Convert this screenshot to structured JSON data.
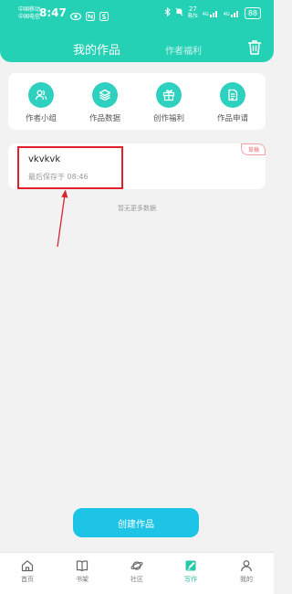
{
  "status_bar": {
    "carrier_1": "中国移动",
    "carrier_2": "中国电信",
    "time": "8:47",
    "network_speed": "27",
    "network_unit": "B/s",
    "network_type": "4G",
    "network_type_2": "4G",
    "battery": "88"
  },
  "header": {
    "tabs": [
      {
        "label": "我的作品",
        "active": true
      },
      {
        "label": "作者福利",
        "active": false
      }
    ]
  },
  "quick_actions": [
    {
      "label": "作者小组",
      "icon": "people-icon"
    },
    {
      "label": "作品数据",
      "icon": "layers-icon"
    },
    {
      "label": "创作福利",
      "icon": "gift-icon"
    },
    {
      "label": "作品申请",
      "icon": "document-icon"
    }
  ],
  "work": {
    "title": "vkvkvk",
    "save_time": "最后保存于 08:46",
    "badge": "草稿"
  },
  "list_end_text": "暂无更多数据",
  "create_button": "创建作品",
  "tab_bar": [
    {
      "label": "首页",
      "icon": "home-icon",
      "active": false
    },
    {
      "label": "书架",
      "icon": "book-icon",
      "active": false
    },
    {
      "label": "社区",
      "icon": "planet-icon",
      "active": false
    },
    {
      "label": "写作",
      "icon": "pen-icon",
      "active": true
    },
    {
      "label": "我的",
      "icon": "person-icon",
      "active": false
    }
  ],
  "colors": {
    "header": "#25d1b5",
    "accent_button": "#1dc4e6",
    "annotation": "#e0202c",
    "draft": "#ef6e72"
  }
}
